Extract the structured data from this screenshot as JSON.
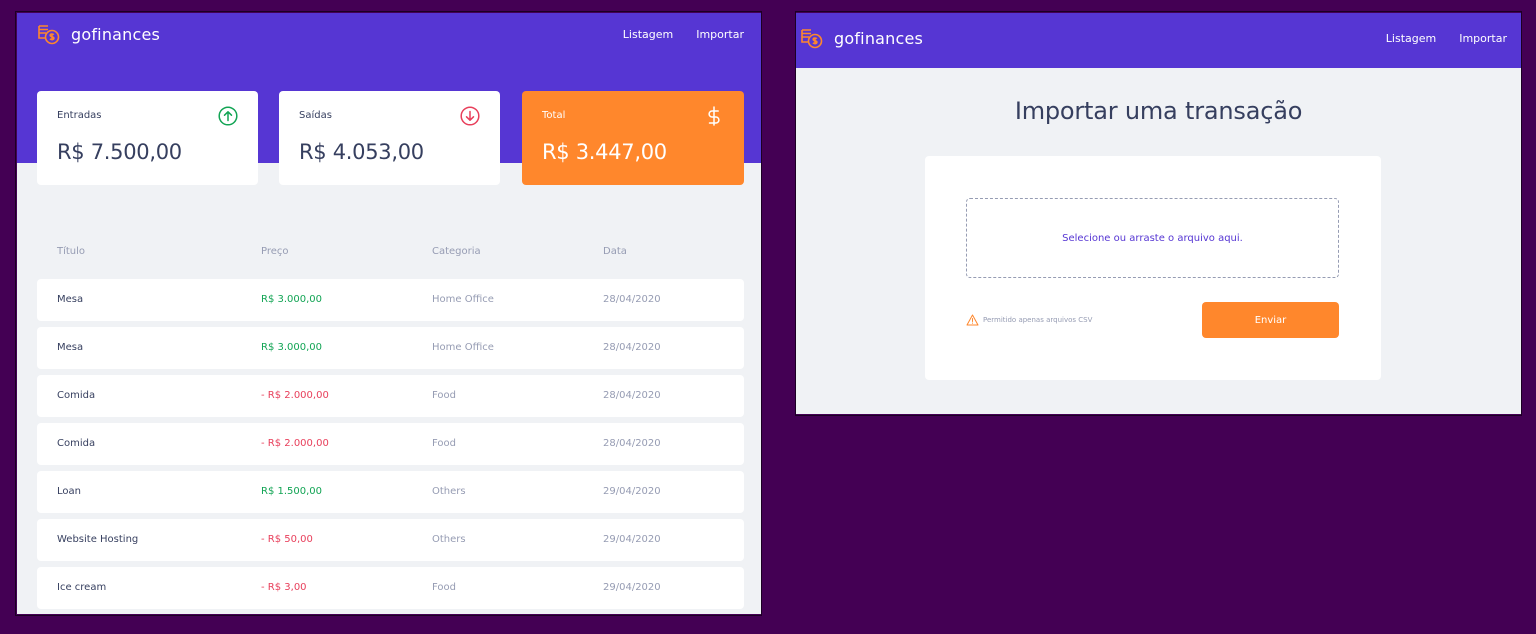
{
  "app": {
    "name": "gofinances"
  },
  "nav": {
    "list": "Listagem",
    "import": "Importar"
  },
  "dashboard": {
    "cards": {
      "income": {
        "label": "Entradas",
        "value": "R$ 7.500,00"
      },
      "outcome": {
        "label": "Saídas",
        "value": "R$ 4.053,00"
      },
      "total": {
        "label": "Total",
        "value": "R$ 3.447,00"
      }
    },
    "table": {
      "headers": {
        "title": "Título",
        "price": "Preço",
        "category": "Categoria",
        "date": "Data"
      },
      "rows": [
        {
          "title": "Mesa",
          "price": "R$ 3.000,00",
          "type": "income",
          "category": "Home Office",
          "date": "28/04/2020"
        },
        {
          "title": "Mesa",
          "price": "R$ 3.000,00",
          "type": "income",
          "category": "Home Office",
          "date": "28/04/2020"
        },
        {
          "title": "Comida",
          "price": "- R$ 2.000,00",
          "type": "outcome",
          "category": "Food",
          "date": "28/04/2020"
        },
        {
          "title": "Comida",
          "price": "- R$ 2.000,00",
          "type": "outcome",
          "category": "Food",
          "date": "28/04/2020"
        },
        {
          "title": "Loan",
          "price": "R$ 1.500,00",
          "type": "income",
          "category": "Others",
          "date": "29/04/2020"
        },
        {
          "title": "Website Hosting",
          "price": "- R$ 50,00",
          "type": "outcome",
          "category": "Others",
          "date": "29/04/2020"
        },
        {
          "title": "Ice cream",
          "price": "- R$ 3,00",
          "type": "outcome",
          "category": "Food",
          "date": "29/04/2020"
        }
      ]
    }
  },
  "import": {
    "title": "Importar uma transação",
    "dropzone": "Selecione ou arraste o arquivo aqui.",
    "hint": "Permitido apenas arquivos CSV",
    "submit": "Enviar"
  },
  "colors": {
    "brand_purple": "#5636d3",
    "accent_orange": "#ff872c",
    "income_green": "#12a454",
    "outcome_red": "#e83f5b",
    "background": "#f0f2f5",
    "page_backdrop": "#440054"
  },
  "icons": {
    "logo": "coins-dollar-icon",
    "income": "arrow-up-circle-icon",
    "outcome": "arrow-down-circle-icon",
    "total": "dollar-sign-icon",
    "hint": "alert-triangle-icon"
  }
}
